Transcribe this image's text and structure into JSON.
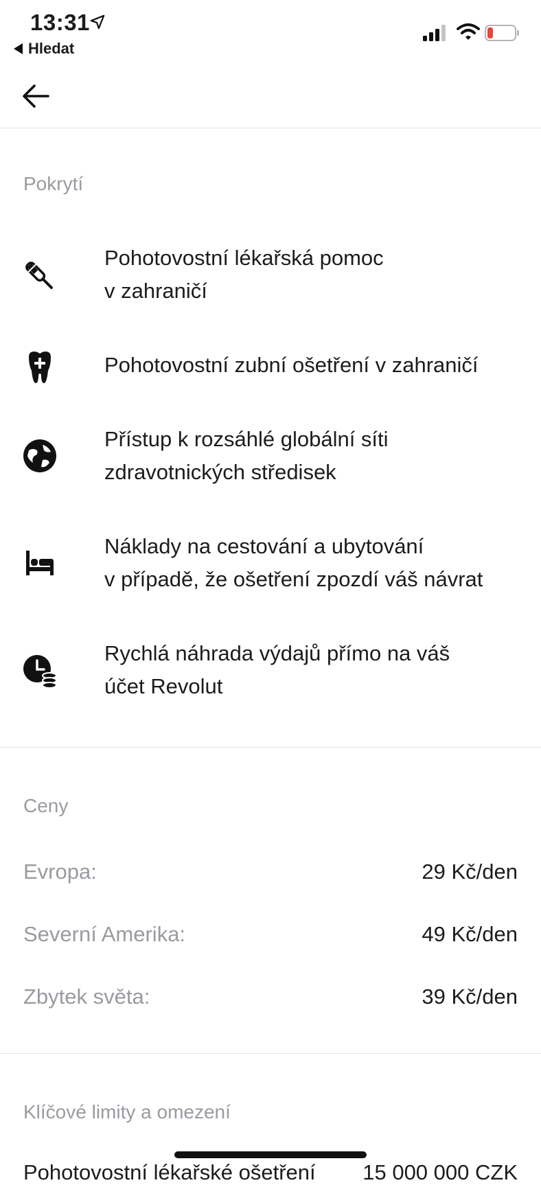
{
  "status_bar": {
    "time": "13:31",
    "back_app_label": "Hledat",
    "battery_color": "#e5463b"
  },
  "nav": {
    "back_icon": "arrow-left-icon"
  },
  "coverage": {
    "title": "Pokrytí",
    "items": [
      {
        "icon": "crutch-icon",
        "line1": "Pohotovostní lékařská pomoc",
        "line2": "v zahraničí"
      },
      {
        "icon": "tooth-plus-icon",
        "line1": "Pohotovostní zubní ošetření v zahraničí",
        "line2": ""
      },
      {
        "icon": "globe-icon",
        "line1": "Přístup k rozsáhlé globální síti",
        "line2": "zdravotnických středisek"
      },
      {
        "icon": "bed-icon",
        "line1": "Náklady na cestování a ubytování",
        "line2": "v případě, že ošetření zpozdí váš návrat"
      },
      {
        "icon": "clock-coins-icon",
        "line1": "Rychlá náhrada výdajů přímo na váš",
        "line2": "účet Revolut"
      }
    ]
  },
  "prices": {
    "title": "Ceny",
    "rows": [
      {
        "label": "Evropa:",
        "value": "29 Kč/den"
      },
      {
        "label": "Severní Amerika:",
        "value": "49 Kč/den"
      },
      {
        "label": "Zbytek světa:",
        "value": "39 Kč/den"
      }
    ]
  },
  "limits": {
    "title": "Klíčové limity a omezení",
    "partial_label": "Pohotovostní lékařské ošetření",
    "partial_value": "15 000 000 CZK"
  }
}
